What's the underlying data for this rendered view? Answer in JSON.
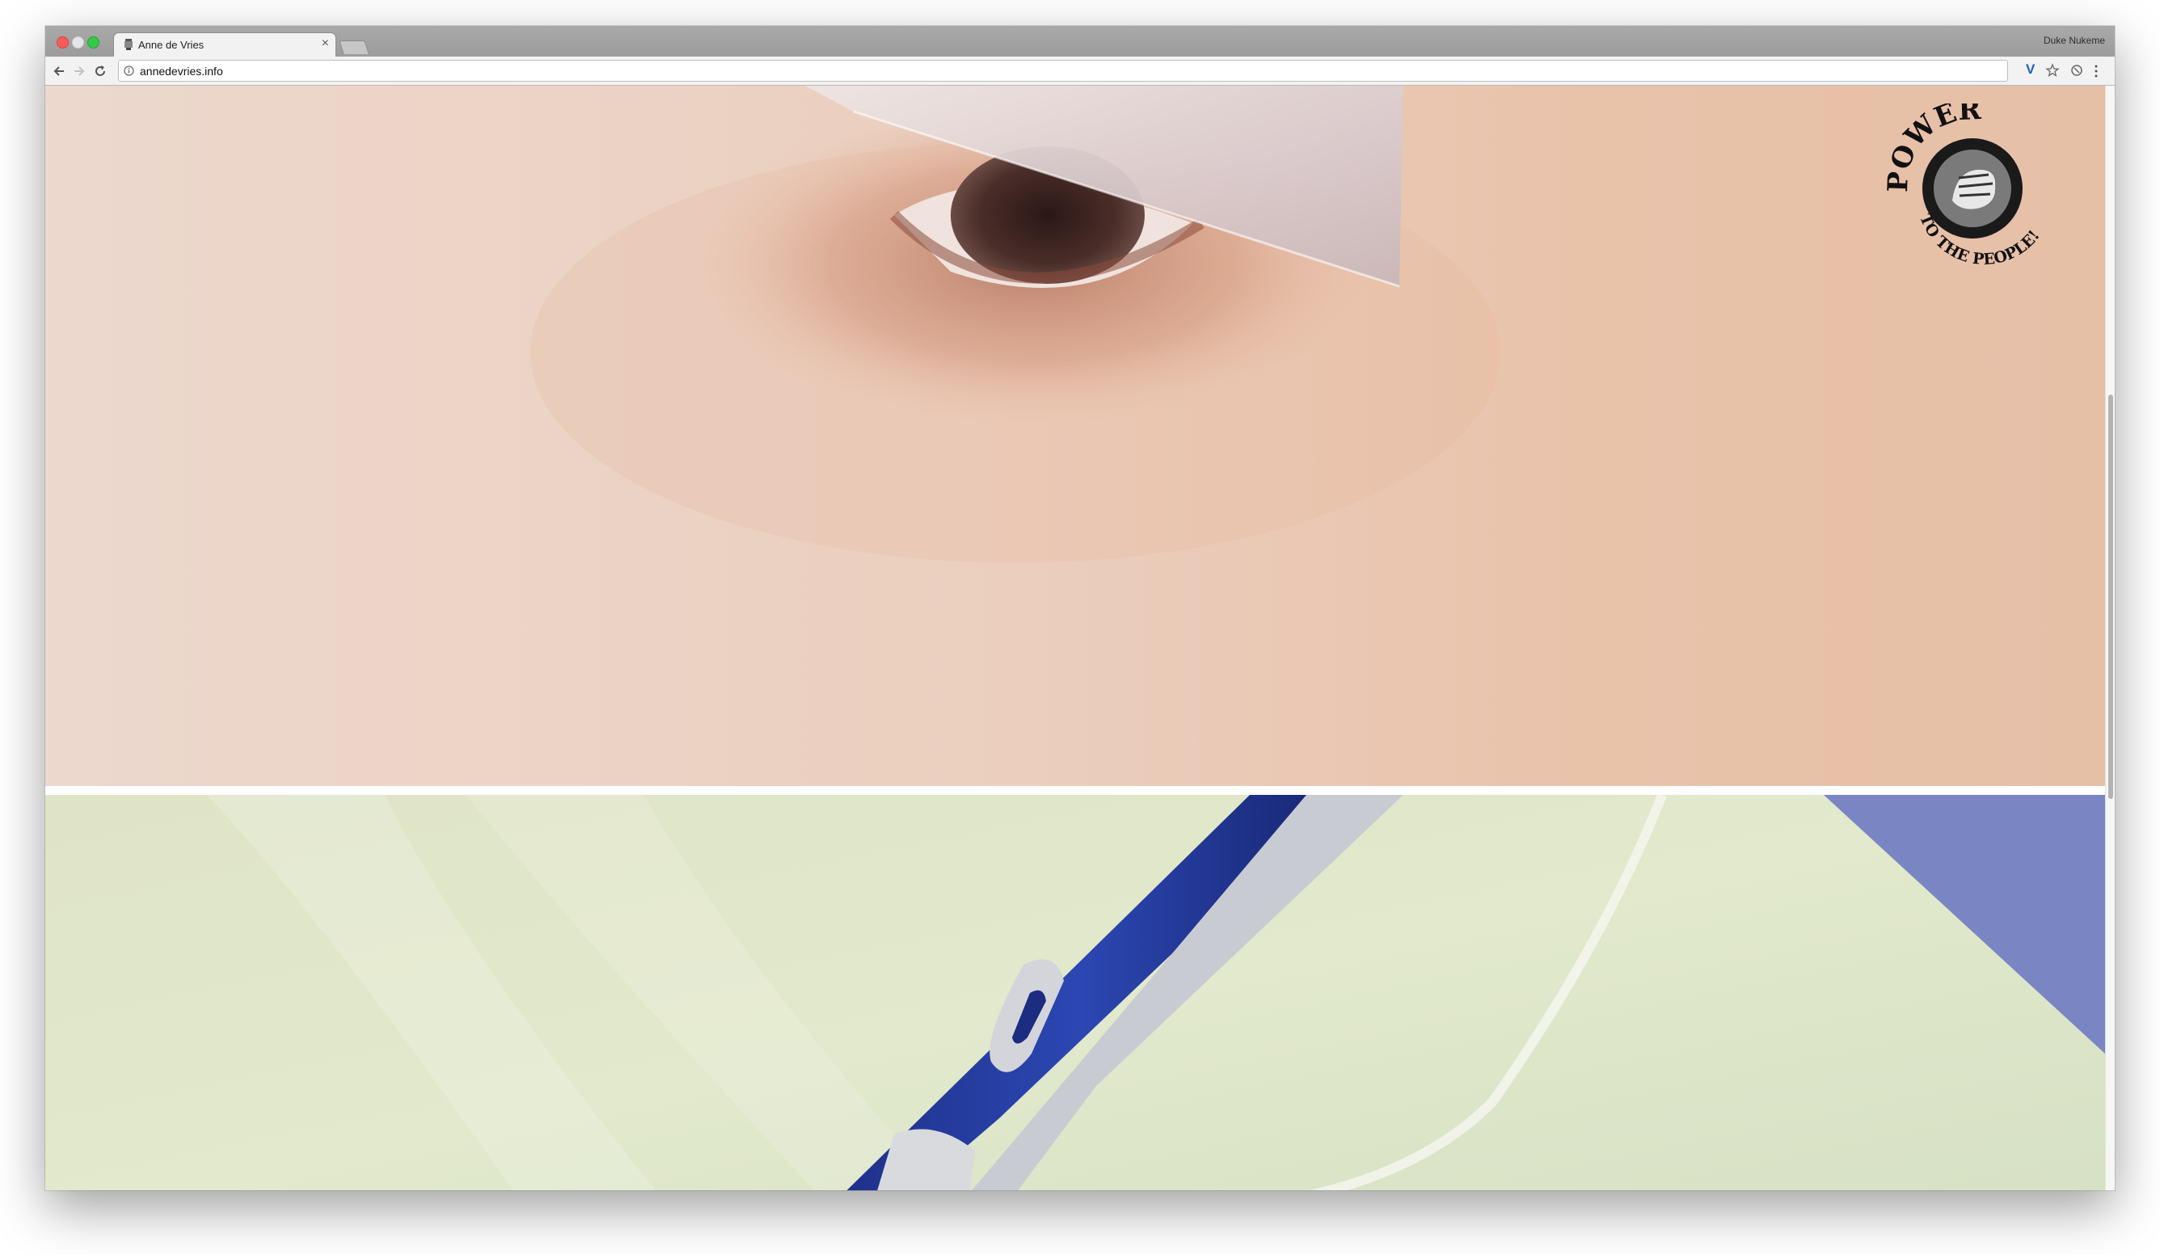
{
  "window": {
    "tab": {
      "title": "Anne de Vries",
      "close_glyph": "×"
    },
    "profile_name": "Duke Nukeme"
  },
  "toolbar": {
    "url": "annedevries.info",
    "extension_label": "V"
  },
  "icons": {
    "back": "arrow-left-icon",
    "forward": "arrow-right-icon",
    "reload": "reload-icon",
    "info": "info-icon",
    "star": "star-icon",
    "menu": "kebab-menu-icon"
  },
  "content": {
    "images": [
      "close-up eye with plastic sheet",
      "blue and grey razor on pale green background"
    ],
    "logo": {
      "top_text": "POWER",
      "bottom_text": "TO THE PEOPLE!"
    }
  },
  "colors": {
    "skin": "#e9c9b2",
    "razor_bg": "#e3e8c6",
    "razor_blue": "#243d9c",
    "accent_purple": "#7a86c4"
  }
}
